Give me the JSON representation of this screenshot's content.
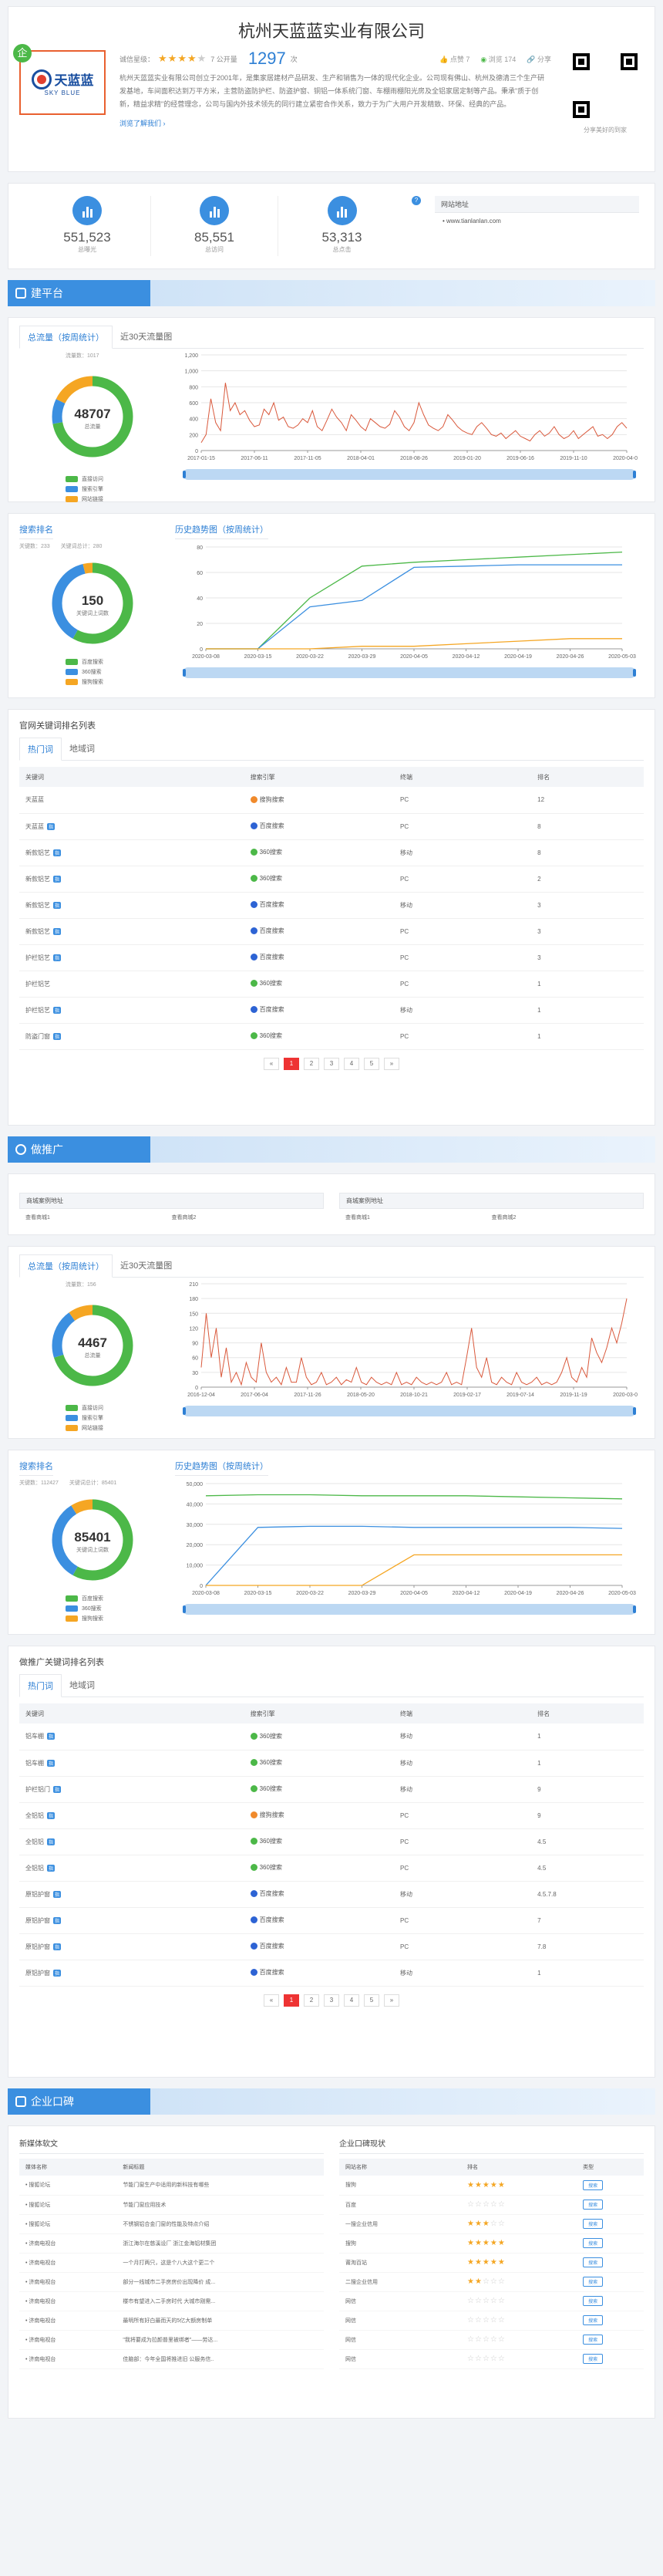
{
  "company": {
    "name": "杭州天蓝蓝实业有限公司",
    "logo_cn": "天蓝蓝",
    "logo_en": "SKY BLUE",
    "vip_badge": "企",
    "rating_label": "诚信星级：",
    "stars": 4,
    "open_label": "7 公开量",
    "open_count": "1297",
    "open_unit": "次",
    "likes": "点赞 7",
    "views": "浏览 174",
    "share": "分享",
    "description": "杭州天蓝蓝实业有限公司创立于2001年，是集家居建材产品研发、生产和销售为一体的现代化企业。公司现有佛山、杭州及德清三个生产研发基地，车间面积达到万平方米，主营防盗防护栏、防盗护窗、铜铝一体系统门窗、车棚雨棚阳光房及全铝家居定制等产品。秉承\"质于创新，精益求精\"的经营理念，公司与国内外技术领先的同行建立紧密合作关系，致力于为广大用户开发精致、环保、经典的产品。",
    "more_link": "浏览了解我们",
    "qr_caption": "分享美好的到家"
  },
  "stats": [
    {
      "value": "551,523",
      "label": "总曝光"
    },
    {
      "value": "85,551",
      "label": "总访问"
    },
    {
      "value": "53,313",
      "label": "总点击"
    }
  ],
  "site": {
    "header": "网站地址",
    "url": "www.tianlanlan.com"
  },
  "sections": {
    "build": "建平台",
    "promo": "做推广",
    "reputation": "企业口碑"
  },
  "build": {
    "tab_total": "总流量（按周统计）",
    "tab_30days": "近30天流量图",
    "traffic_sub": "流量数：1017",
    "traffic_total": "48707",
    "traffic_total_label": "总流量",
    "legend": [
      "直接访问",
      "搜索引擎",
      "网站链接"
    ],
    "rank_title": "搜索排名",
    "rank_sub1": "关键数：233",
    "rank_sub2": "关键词总计：280",
    "rank_total": "150",
    "rank_total_label": "关键词上词数",
    "rank_legend": [
      "百度搜索",
      "360搜索",
      "搜狗搜索"
    ],
    "history_title": "历史趋势图（按周统计）",
    "kw_title": "官网关键词排名列表",
    "kw_tabs": [
      "热门词",
      "地域词"
    ],
    "kw_headers": [
      "关键词",
      "搜索引擎",
      "终端",
      "排名"
    ],
    "kw_rows": [
      {
        "kw": "天蓝蓝",
        "badge": "",
        "engine": "搜狗搜索",
        "term": "PC",
        "rank": "12"
      },
      {
        "kw": "天蓝蓝",
        "badge": "指",
        "engine": "百度搜索",
        "term": "PC",
        "rank": "8"
      },
      {
        "kw": "新款铝艺",
        "badge": "指",
        "engine": "360搜索",
        "term": "移动",
        "rank": "8"
      },
      {
        "kw": "新款铝艺",
        "badge": "指",
        "engine": "360搜索",
        "term": "PC",
        "rank": "2"
      },
      {
        "kw": "新款铝艺",
        "badge": "指",
        "engine": "百度搜索",
        "term": "移动",
        "rank": "3"
      },
      {
        "kw": "新款铝艺",
        "badge": "指",
        "engine": "百度搜索",
        "term": "PC",
        "rank": "3"
      },
      {
        "kw": "护栏铝艺",
        "badge": "指",
        "engine": "百度搜索",
        "term": "PC",
        "rank": "3"
      },
      {
        "kw": "护栏铝艺",
        "badge": "",
        "engine": "360搜索",
        "term": "PC",
        "rank": "1"
      },
      {
        "kw": "护栏铝艺",
        "badge": "指",
        "engine": "百度搜索",
        "term": "移动",
        "rank": "1"
      },
      {
        "kw": "防盗门窗",
        "badge": "指",
        "engine": "360搜索",
        "term": "PC",
        "rank": "1"
      }
    ],
    "pager": [
      "«",
      "1",
      "2",
      "3",
      "4",
      "5",
      "»"
    ]
  },
  "promo": {
    "case_head_left": "商城案例地址",
    "case_head_right": "商城案例地址",
    "case_links_left": [
      "查看商城1",
      "查看商城2"
    ],
    "case_links_right": [
      "查看商城1",
      "查看商城2"
    ],
    "tab_total": "总流量（按周统计）",
    "tab_30days": "近30天流量图",
    "traffic_sub": "流量数：156",
    "traffic_total": "4467",
    "traffic_total_label": "总流量",
    "legend": [
      "直接访问",
      "搜索引擎",
      "网站链接"
    ],
    "rank_title": "搜索排名",
    "rank_sub1": "关键数：112427",
    "rank_sub2": "关键词总计：85401",
    "rank_total": "85401",
    "rank_total_label": "关键词上词数",
    "rank_legend": [
      "百度搜索",
      "360搜索",
      "搜狗搜索"
    ],
    "history_title": "历史趋势图（按周统计）",
    "kw_title": "做推广关键词排名列表",
    "kw_tabs": [
      "热门词",
      "地域词"
    ],
    "kw_headers": [
      "关键词",
      "搜索引擎",
      "终端",
      "排名"
    ],
    "kw_rows": [
      {
        "kw": "铝车棚",
        "badge": "指",
        "engine": "360搜索",
        "term": "移动",
        "rank": "1"
      },
      {
        "kw": "铝车棚",
        "badge": "指",
        "engine": "360搜索",
        "term": "移动",
        "rank": "1"
      },
      {
        "kw": "护栏铝门",
        "badge": "指",
        "engine": "360搜索",
        "term": "移动",
        "rank": "9"
      },
      {
        "kw": "全铝铝",
        "badge": "指",
        "engine": "搜狗搜索",
        "term": "PC",
        "rank": "9"
      },
      {
        "kw": "全铝铝",
        "badge": "指",
        "engine": "360搜索",
        "term": "PC",
        "rank": "4.5"
      },
      {
        "kw": "全铝铝",
        "badge": "指",
        "engine": "360搜索",
        "term": "PC",
        "rank": "4.5"
      },
      {
        "kw": "原铝护窗",
        "badge": "指",
        "engine": "百度搜索",
        "term": "移动",
        "rank": "4.5.7.8"
      },
      {
        "kw": "原铝护窗",
        "badge": "指",
        "engine": "百度搜索",
        "term": "PC",
        "rank": "7"
      },
      {
        "kw": "原铝护窗",
        "badge": "指",
        "engine": "百度搜索",
        "term": "PC",
        "rank": "7.8"
      },
      {
        "kw": "原铝护窗",
        "badge": "指",
        "engine": "百度搜索",
        "term": "移动",
        "rank": "1"
      }
    ],
    "pager": [
      "«",
      "1",
      "2",
      "3",
      "4",
      "5",
      "»"
    ]
  },
  "reputation": {
    "media_title": "新媒体软文",
    "media_headers": [
      "媒体名称",
      "新闻标题"
    ],
    "media_rows": [
      {
        "media": "搜狐论坛",
        "title": "节能门窗生产中适用的新科技有哪些"
      },
      {
        "media": "搜狐论坛",
        "title": "节能门窗应用技术"
      },
      {
        "media": "搜狐论坛",
        "title": "不锈钢铝合金门窗的性能及特点介绍"
      },
      {
        "media": "济南电视台",
        "title": "浙江海尔在慈溪设厂 浙江金海铝材集团"
      },
      {
        "media": "济南电视台",
        "title": "一个月打两只，这是个八大这个更二个"
      },
      {
        "media": "济南电视台",
        "title": "部分一线城市二手房房价出现降价 成..."
      },
      {
        "media": "济南电视台",
        "title": "楼市有望进入二手房时代 大城市刚需..."
      },
      {
        "media": "济南电视台",
        "title": "最明所有好白最而天的5亿大额房制单"
      },
      {
        "media": "济南电视台",
        "title": "\"我将要成为拉颜普里被绑者\"——劳达..."
      },
      {
        "media": "济南电视台",
        "title": "佳脑部：今年全国将推进旧 公服务信.."
      }
    ],
    "rep_title": "企业口碑现状",
    "rep_headers": [
      "网站名称",
      "排名",
      "类型"
    ],
    "rep_rows": [
      {
        "site": "搜狗",
        "stars": 5,
        "type": "搜索"
      },
      {
        "site": "百度",
        "stars": 0,
        "type": "搜索"
      },
      {
        "site": "一搜企业信用",
        "stars": 3,
        "type": "搜索"
      },
      {
        "site": "搜狗",
        "stars": 5,
        "type": "搜索"
      },
      {
        "site": "莆淘百站",
        "stars": 5,
        "type": "搜索"
      },
      {
        "site": "二搜企业信用",
        "stars": 2,
        "type": "搜索"
      },
      {
        "site": "网信",
        "stars": 0,
        "type": "搜索"
      },
      {
        "site": "网信",
        "stars": 0,
        "type": "搜索"
      },
      {
        "site": "网信",
        "stars": 0,
        "type": "搜索"
      },
      {
        "site": "网信",
        "stars": 0,
        "type": "搜索"
      }
    ]
  },
  "colors": {
    "blue": "#3b8fe0",
    "green": "#4cb848",
    "orange": "#f5a623",
    "line": "#d9583b",
    "accent": "#2d7fd4"
  },
  "chart_data": [
    {
      "type": "pie",
      "id": "build-traffic-donut",
      "categories": [
        "直接访问",
        "搜索引擎",
        "网站链接"
      ],
      "values": [
        72,
        10,
        18
      ],
      "colors": [
        "#4cb848",
        "#3b8fe0",
        "#f5a623"
      ]
    },
    {
      "type": "line",
      "id": "build-traffic-line",
      "x_ticks": [
        "2017-01-15",
        "2017-06-11",
        "2017-11-05",
        "2018-04-01",
        "2018-08-26",
        "2019-01-20",
        "2019-06-16",
        "2019-11-10",
        "2020-04-05"
      ],
      "ylim": [
        0,
        1200
      ],
      "y_ticks": [
        0,
        200,
        400,
        600,
        800,
        1000,
        1200
      ],
      "values": [
        100,
        200,
        650,
        350,
        250,
        850,
        500,
        600,
        450,
        500,
        380,
        300,
        320,
        520,
        450,
        600,
        380,
        420,
        300,
        280,
        320,
        400,
        350,
        500,
        300,
        250,
        380,
        520,
        420,
        350,
        250,
        450,
        380,
        300,
        250,
        400,
        350,
        300,
        280,
        330,
        500,
        420,
        300,
        250,
        350,
        600,
        450,
        320,
        280,
        250,
        300,
        450,
        380,
        300,
        250,
        220,
        200,
        300,
        350,
        280,
        200,
        180,
        220,
        150,
        200,
        250,
        180,
        150,
        120,
        200,
        250,
        180,
        220,
        300,
        200,
        150,
        180,
        250,
        150,
        200,
        250,
        300,
        180,
        200,
        150,
        200,
        300,
        350,
        280
      ]
    },
    {
      "type": "pie",
      "id": "build-rank-donut",
      "categories": [
        "百度搜索",
        "360搜索",
        "搜狗搜索"
      ],
      "values": [
        58,
        38,
        4
      ],
      "colors": [
        "#4cb848",
        "#3b8fe0",
        "#f5a623"
      ]
    },
    {
      "type": "line",
      "id": "build-history",
      "x": [
        "2020-03-08",
        "2020-03-15",
        "2020-03-22",
        "2020-03-29",
        "2020-04-05",
        "2020-04-12",
        "2020-04-19",
        "2020-04-26",
        "2020-05-03"
      ],
      "ylim": [
        0,
        80
      ],
      "y_ticks": [
        0,
        20,
        40,
        60,
        80
      ],
      "series": [
        {
          "name": "百度搜索",
          "color": "#4cb848",
          "values": [
            0,
            0,
            40,
            65,
            68,
            70,
            72,
            74,
            76
          ]
        },
        {
          "name": "360搜索",
          "color": "#3b8fe0",
          "values": [
            0,
            0,
            33,
            38,
            64,
            65,
            66,
            66,
            66
          ]
        },
        {
          "name": "搜狗搜索",
          "color": "#f5a623",
          "values": [
            0,
            0,
            0,
            2,
            2,
            4,
            6,
            8,
            8
          ]
        }
      ]
    },
    {
      "type": "pie",
      "id": "promo-traffic-donut",
      "categories": [
        "直接访问",
        "搜索引擎",
        "网站链接"
      ],
      "values": [
        70,
        20,
        10
      ],
      "colors": [
        "#4cb848",
        "#3b8fe0",
        "#f5a623"
      ]
    },
    {
      "type": "line",
      "id": "promo-traffic-line",
      "x_ticks": [
        "2016-12-04",
        "2017-06-04",
        "2017-11-26",
        "2018-05-20",
        "2018-10-21",
        "2019-02-17",
        "2019-07-14",
        "2019-11-19",
        "2020-03-08"
      ],
      "ylim": [
        0,
        210
      ],
      "y_ticks": [
        0,
        30,
        60,
        90,
        120,
        150,
        180,
        210
      ],
      "values": [
        40,
        150,
        60,
        120,
        20,
        80,
        10,
        30,
        5,
        50,
        20,
        10,
        90,
        30,
        10,
        20,
        5,
        40,
        10,
        10,
        60,
        20,
        5,
        10,
        30,
        5,
        10,
        20,
        5,
        15,
        10,
        40,
        10,
        5,
        20,
        10,
        5,
        10,
        5,
        30,
        5,
        10,
        5,
        20,
        10,
        5,
        10,
        5,
        10,
        30,
        5,
        10,
        5,
        60,
        120,
        40,
        20,
        60,
        10,
        5,
        20,
        10,
        5,
        30,
        10,
        5,
        10,
        20,
        5,
        10,
        5,
        10,
        30,
        60,
        20,
        10,
        40,
        20,
        100,
        70,
        50,
        80,
        120,
        90,
        130,
        180
      ]
    },
    {
      "type": "pie",
      "id": "promo-rank-donut",
      "categories": [
        "百度搜索",
        "360搜索",
        "搜狗搜索"
      ],
      "values": [
        58,
        33,
        9
      ],
      "colors": [
        "#4cb848",
        "#3b8fe0",
        "#f5a623"
      ]
    },
    {
      "type": "line",
      "id": "promo-history",
      "x": [
        "2020-03-08",
        "2020-03-15",
        "2020-03-22",
        "2020-03-29",
        "2020-04-05",
        "2020-04-12",
        "2020-04-19",
        "2020-04-26",
        "2020-05-03"
      ],
      "ylim": [
        0,
        50000
      ],
      "y_ticks": [
        0,
        10000,
        20000,
        30000,
        40000,
        50000
      ],
      "series": [
        {
          "name": "百度搜索",
          "color": "#4cb848",
          "values": [
            44000,
            44500,
            44500,
            44000,
            44000,
            44000,
            43500,
            43000,
            42500
          ]
        },
        {
          "name": "360搜索",
          "color": "#3b8fe0",
          "values": [
            0,
            28500,
            29000,
            29000,
            28500,
            28500,
            28500,
            28500,
            28000
          ]
        },
        {
          "name": "搜狗搜索",
          "color": "#f5a623",
          "values": [
            0,
            0,
            0,
            0,
            15000,
            15000,
            15000,
            15000,
            15000
          ]
        }
      ]
    }
  ]
}
